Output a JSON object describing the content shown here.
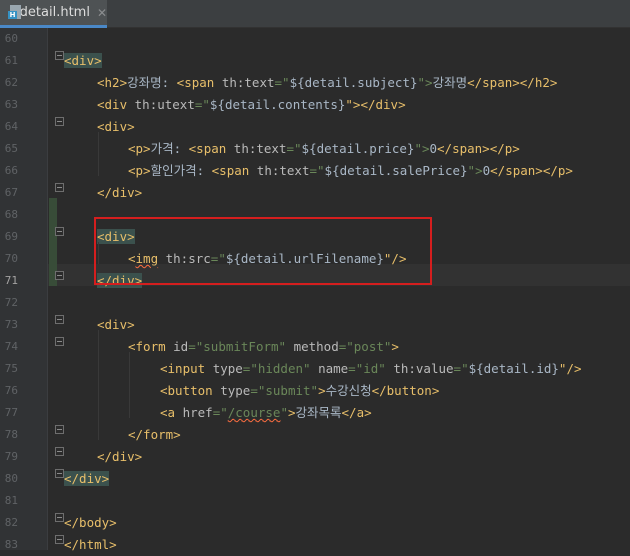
{
  "tab": {
    "filename": "detail.html",
    "close_glyph": "✕",
    "icon": "html-file-icon"
  },
  "editor": {
    "current_line": 71,
    "lines": [
      {
        "num": "60"
      },
      {
        "num": "61"
      },
      {
        "num": "62",
        "t": [
          [
            "      ",
            ""
          ],
          [
            "<h2>",
            "tg"
          ],
          [
            "강좌명: ",
            ""
          ],
          [
            "<span ",
            "tg"
          ],
          [
            "th:text",
            "at"
          ],
          [
            "=\"",
            "st"
          ],
          [
            "${",
            "ex"
          ],
          [
            "detail.subject",
            "ex"
          ],
          [
            "}",
            "ex"
          ],
          [
            "\"",
            "st"
          ],
          [
            ">",
            "tg"
          ],
          [
            "강좌명",
            ""
          ],
          [
            "</span>",
            "tg"
          ],
          [
            "</h2>",
            "tg"
          ]
        ]
      },
      {
        "num": "63"
      },
      {
        "num": "64"
      },
      {
        "num": "65"
      },
      {
        "num": "66"
      },
      {
        "num": "67"
      },
      {
        "num": "68"
      },
      {
        "num": "69"
      },
      {
        "num": "70"
      },
      {
        "num": "71"
      },
      {
        "num": "72"
      },
      {
        "num": "73"
      },
      {
        "num": "74"
      },
      {
        "num": "75"
      },
      {
        "num": "76"
      },
      {
        "num": "77"
      },
      {
        "num": "78"
      },
      {
        "num": "79"
      },
      {
        "num": "80"
      },
      {
        "num": "81"
      },
      {
        "num": "82"
      },
      {
        "num": "83"
      }
    ],
    "code": {
      "l61": "<div>",
      "l62a": "<h2>",
      "l62b": "강좌명: ",
      "l62c": "<span ",
      "l62d": "th:text",
      "l62e": "=\"",
      "l62f": "${detail.subject}",
      "l62g": "\">",
      "l62h": "강좌명",
      "l62i": "</span></h2>",
      "l63a": "<div ",
      "l63b": "th:utext",
      "l63c": "=\"",
      "l63d": "${detail.contents}",
      "l63e": "\"></div>",
      "l64": "<div>",
      "l65a": "<p>",
      "l65b": "가격: ",
      "l65c": "<span ",
      "l65d": "th:text",
      "l65e": "=\"",
      "l65f": "${detail.price}",
      "l65g": "\">",
      "l65h": "0",
      "l65i": "</span></p>",
      "l66a": "<p>",
      "l66b": "할인가격: ",
      "l66c": "<span ",
      "l66d": "th:text",
      "l66e": "=\"",
      "l66f": "${detail.salePrice}",
      "l66g": "\">",
      "l66h": "0",
      "l66i": "</span></p>",
      "l67": "</div>",
      "l69": "<div>",
      "l70a": "<",
      "l70b": "img",
      "l70c": " th:src",
      "l70d": "=\"",
      "l70e": "${detail.urlFilename}",
      "l70f": "\"/>",
      "l71": "</div>",
      "l73": "<div>",
      "l74a": "<form ",
      "l74b": "id",
      "l74c": "=\"submitForm\" ",
      "l74d": "method",
      "l74e": "=\"post\"",
      "l74f": ">",
      "l75a": "<input ",
      "l75b": "type",
      "l75c": "=\"hidden\" ",
      "l75d": "name",
      "l75e": "=\"id\" ",
      "l75f": "th:value",
      "l75g": "=\"",
      "l75h": "${detail.id}",
      "l75i": "\"/>",
      "l76a": "<button ",
      "l76b": "type",
      "l76c": "=\"submit\"",
      "l76d": ">",
      "l76e": "수강신청",
      "l76f": "</button>",
      "l77a": "<a ",
      "l77b": "href",
      "l77c": "=\"",
      "l77d": "/course",
      "l77e": "\"",
      "l77f": ">",
      "l77g": "강좌목록",
      "l77h": "</a>",
      "l78": "</form>",
      "l79": "</div>",
      "l80": "</div>",
      "l82": "</body>",
      "l83": "</html>"
    }
  },
  "colors": {
    "background": "#2b2b2b",
    "tag": "#e8bf6a",
    "attribute": "#bababa",
    "string": "#6a8759",
    "highlight_box": "#d51e1e"
  }
}
